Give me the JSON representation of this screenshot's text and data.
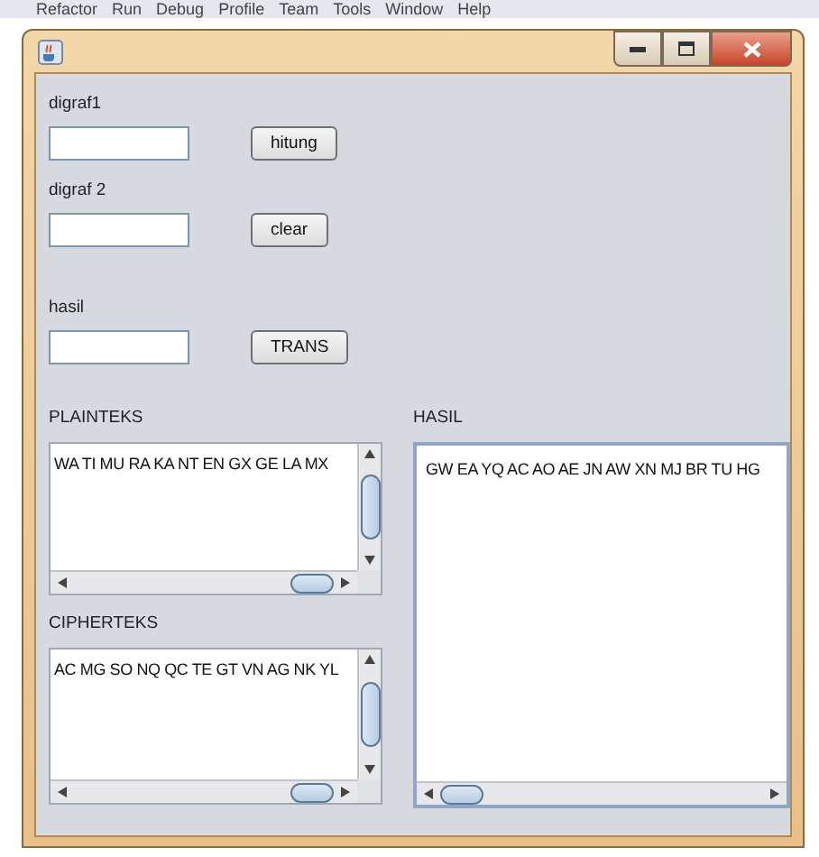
{
  "background_menu": [
    "Refactor",
    "Run",
    "Debug",
    "Profile",
    "Team",
    "Tools",
    "Window",
    "Help"
  ],
  "rows": [
    {
      "label": "digraf1",
      "button": "hitung"
    },
    {
      "label": "digraf 2",
      "button": "clear"
    },
    {
      "label": "hasil",
      "button": "TRANS"
    }
  ],
  "plainteks": {
    "label": "PLAINTEKS",
    "text": "WA TI MU RA KA NT EN GX GE LA MX"
  },
  "cipherteks": {
    "label": "CIPHERTEKS",
    "text": "AC MG SO NQ QC TE GT VN AG NK YL"
  },
  "hasil": {
    "label": "HASIL",
    "text": "GW EA YQ AC AO AE JN AW XN MJ BR TU HG"
  }
}
